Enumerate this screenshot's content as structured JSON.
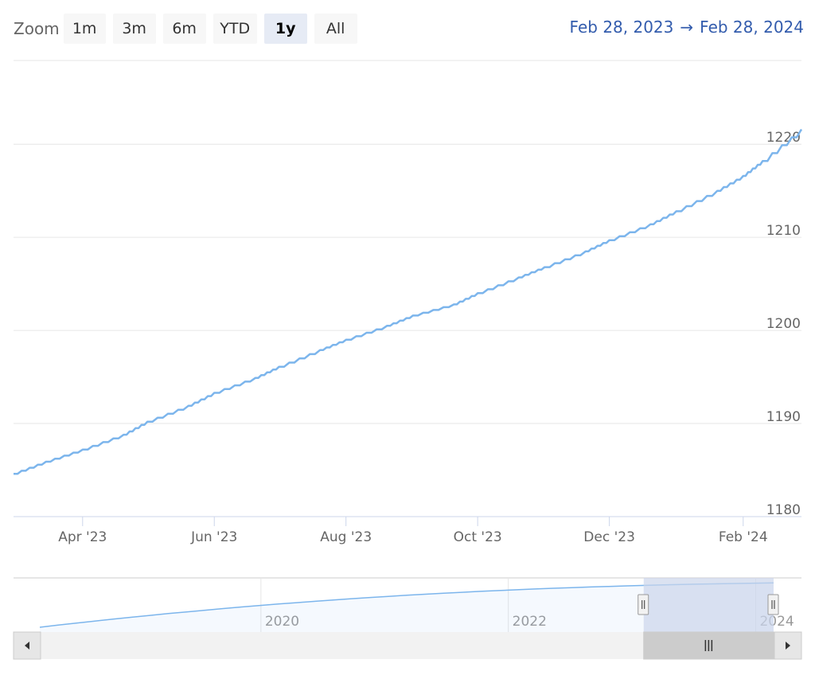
{
  "zoom": {
    "label": "Zoom",
    "buttons": [
      {
        "label": "1m",
        "active": false
      },
      {
        "label": "3m",
        "active": false
      },
      {
        "label": "6m",
        "active": false
      },
      {
        "label": "YTD",
        "active": false
      },
      {
        "label": "1y",
        "active": true
      },
      {
        "label": "All",
        "active": false
      }
    ]
  },
  "range": {
    "from": "Feb 28, 2023",
    "arrow": "→",
    "to": "Feb 28, 2024"
  },
  "colors": {
    "series": "#7cb5ec",
    "navigator_fill": "#ccd6eb",
    "scrollbar": "#f2f2f2",
    "range_text": "#335cad"
  },
  "chart_data": {
    "type": "line",
    "title": "",
    "xlabel": "",
    "ylabel": "",
    "x_range": [
      "2023-02-28",
      "2024-02-28"
    ],
    "ylim": [
      1180,
      1229
    ],
    "y_ticks": [
      1180,
      1190,
      1200,
      1210,
      1220
    ],
    "y_tick_labels": [
      "1180",
      "1190",
      "1200",
      "1210",
      "1220"
    ],
    "x_ticks": [
      {
        "date": "2023-04-01",
        "label": "Apr '23"
      },
      {
        "date": "2023-06-01",
        "label": "Jun '23"
      },
      {
        "date": "2023-08-01",
        "label": "Aug '23"
      },
      {
        "date": "2023-10-01",
        "label": "Oct '23"
      },
      {
        "date": "2023-12-01",
        "label": "Dec '23"
      },
      {
        "date": "2024-02-01",
        "label": "Feb '24"
      }
    ],
    "grid": true,
    "series": [
      {
        "x": [
          "2023-02-28",
          "2023-03-15",
          "2023-04-01",
          "2023-04-20",
          "2023-05-01",
          "2023-05-20",
          "2023-06-01",
          "2023-06-20",
          "2023-07-01",
          "2023-07-20",
          "2023-08-01",
          "2023-08-20",
          "2023-09-01",
          "2023-09-20",
          "2023-10-01",
          "2023-10-20",
          "2023-11-01",
          "2023-11-20",
          "2023-12-01",
          "2023-12-20",
          "2024-01-01",
          "2024-01-20",
          "2024-02-01",
          "2024-02-10",
          "2024-02-28"
        ],
        "y": [
          1184.6,
          1185.9,
          1187.2,
          1188.8,
          1190.2,
          1191.9,
          1193.3,
          1194.9,
          1196.1,
          1197.9,
          1199.0,
          1200.5,
          1201.6,
          1202.8,
          1204.0,
          1205.7,
          1206.8,
          1208.5,
          1209.7,
          1211.4,
          1212.8,
          1215.0,
          1216.6,
          1218.2,
          1221.6
        ]
      }
    ],
    "navigator": {
      "x_ticks": [
        {
          "year": 2020,
          "label": "2020"
        },
        {
          "year": 2022,
          "label": "2022"
        },
        {
          "year": 2024,
          "label": "2024"
        }
      ],
      "selection": [
        "2023-02-28",
        "2024-02-28"
      ]
    }
  }
}
